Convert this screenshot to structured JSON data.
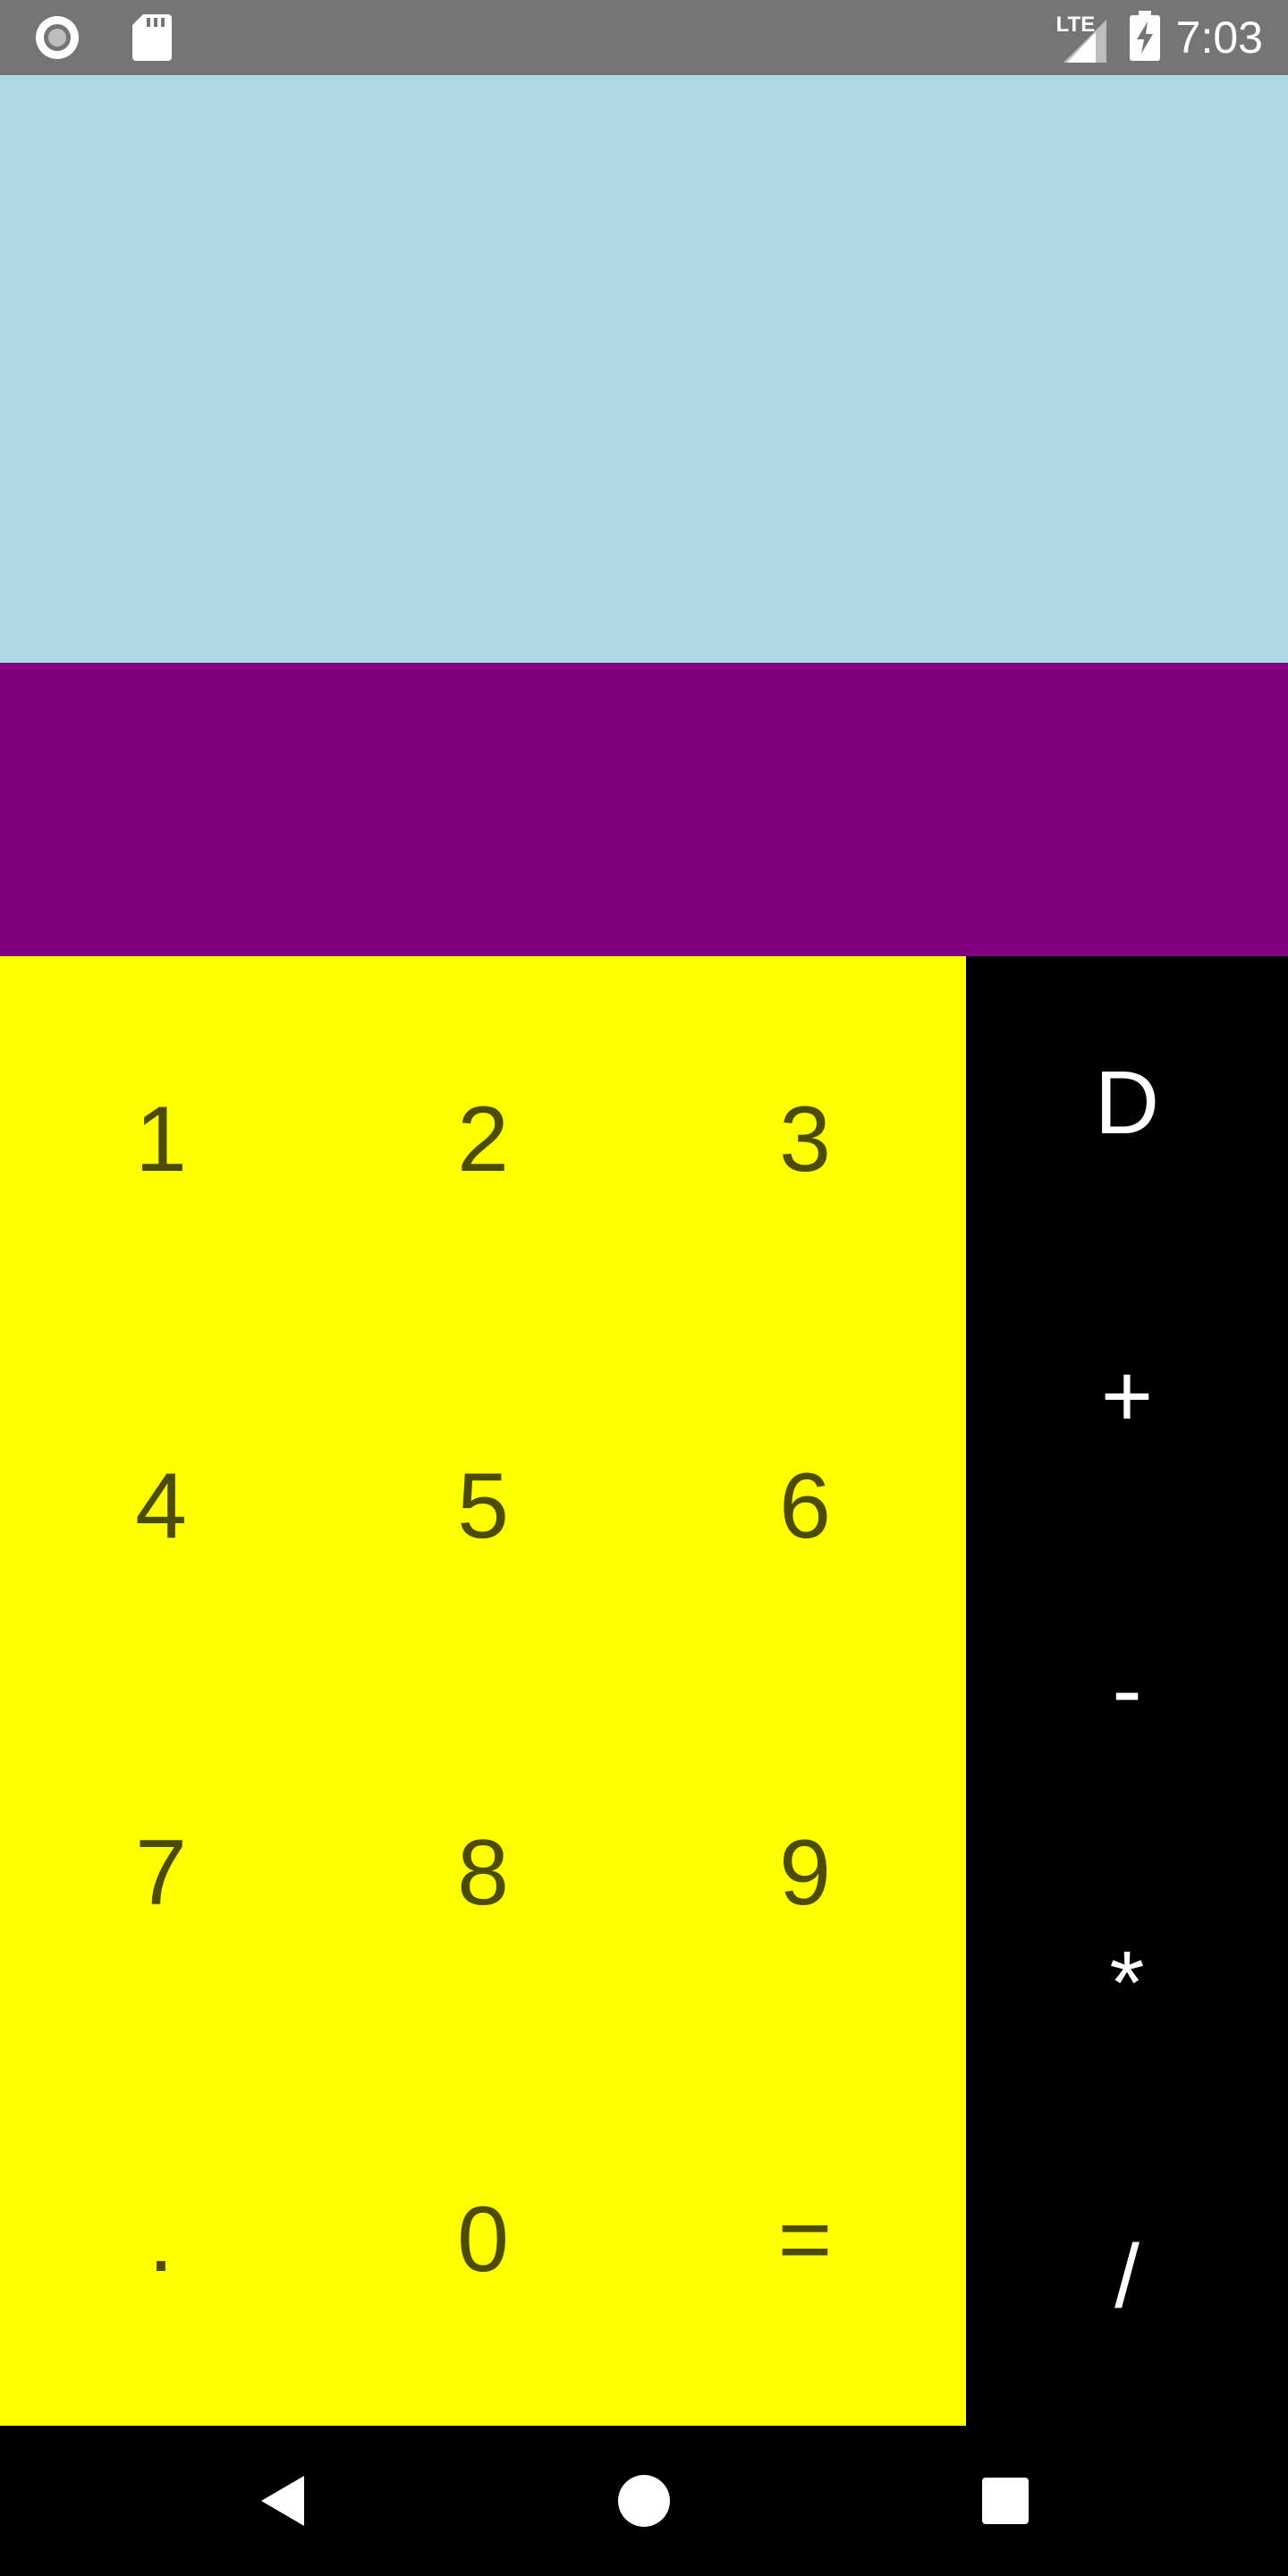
{
  "status_bar": {
    "time": "7:03",
    "network": "LTE",
    "icons": [
      "circle-notification-icon",
      "sd-card-icon",
      "signal-icon",
      "battery-charging-icon"
    ]
  },
  "keypad": {
    "digits": [
      "1",
      "2",
      "3",
      "4",
      "5",
      "6",
      "7",
      "8",
      "9",
      ".",
      "0",
      "="
    ],
    "operators": [
      "D",
      "+",
      "-",
      "*",
      "/"
    ]
  },
  "nav_bar": {
    "icons": [
      "back-icon",
      "home-icon",
      "recents-icon"
    ]
  },
  "colors": {
    "status_bar": "#757575",
    "display": "#add8e6",
    "result": "#800080",
    "numpad": "#ffff00",
    "numpad_text": "#4c4c00",
    "operators_bg": "#000000",
    "operators_text": "#ffffff"
  }
}
